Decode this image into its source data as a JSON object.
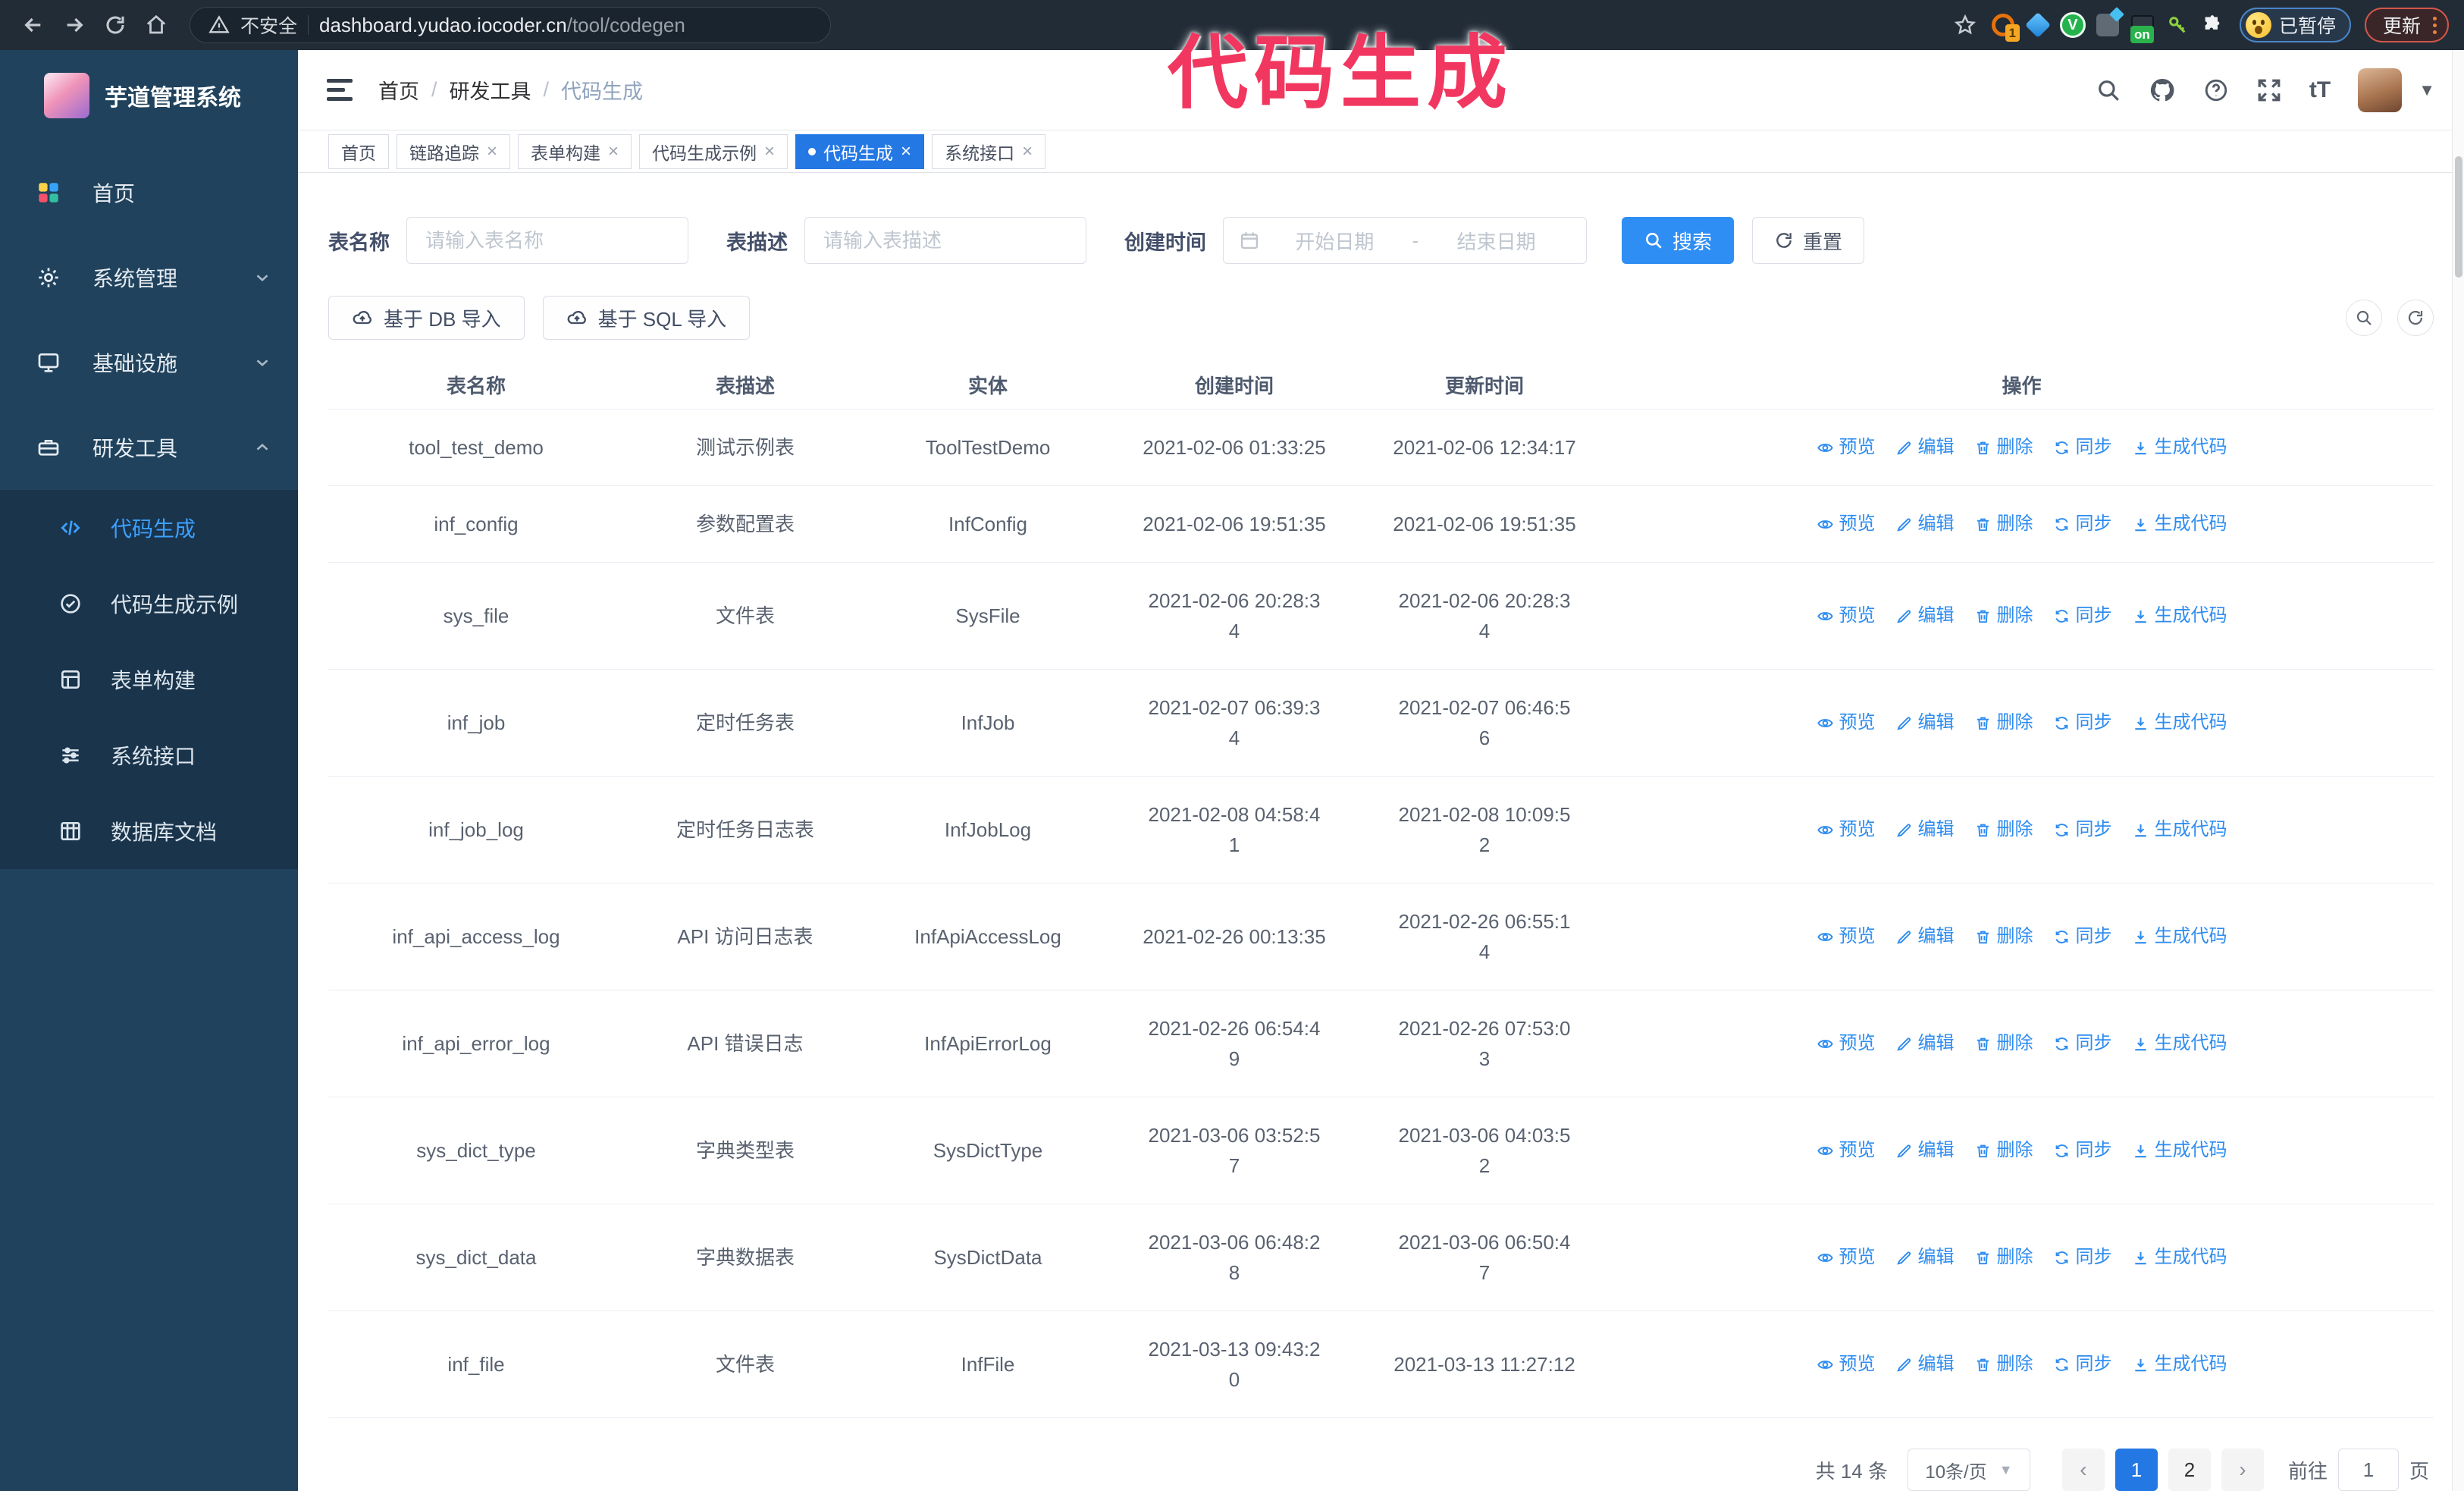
{
  "browser": {
    "security_label": "不安全",
    "url_host": "dashboard.yudao.iocoder.cn",
    "url_path": "/tool/codegen",
    "extension_badge_count": "1",
    "extension_badge_on": "on",
    "profile_badge": "已暂停",
    "update_button": "更新"
  },
  "annotation": {
    "text": "代码生成",
    "color": "#f1375f"
  },
  "sidebar": {
    "app_title": "芋道管理系统",
    "menu": [
      {
        "label": "首页",
        "icon": "dashboard-icon",
        "chevron": null
      },
      {
        "label": "系统管理",
        "icon": "gear-icon",
        "chevron": "down"
      },
      {
        "label": "基础设施",
        "icon": "monitor-icon",
        "chevron": "down"
      },
      {
        "label": "研发工具",
        "icon": "toolbox-icon",
        "chevron": "up"
      }
    ],
    "submenu": [
      {
        "label": "代码生成",
        "icon": "code-icon",
        "active": true
      },
      {
        "label": "代码生成示例",
        "icon": "example-icon",
        "active": false
      },
      {
        "label": "表单构建",
        "icon": "form-icon",
        "active": false
      },
      {
        "label": "系统接口",
        "icon": "api-icon",
        "active": false
      },
      {
        "label": "数据库文档",
        "icon": "db-doc-icon",
        "active": false
      }
    ]
  },
  "header": {
    "breadcrumb": [
      "首页",
      "研发工具",
      "代码生成"
    ]
  },
  "tabs": [
    {
      "label": "首页",
      "closable": false,
      "active": false
    },
    {
      "label": "链路追踪",
      "closable": true,
      "active": false
    },
    {
      "label": "表单构建",
      "closable": true,
      "active": false
    },
    {
      "label": "代码生成示例",
      "closable": true,
      "active": false
    },
    {
      "label": "代码生成",
      "closable": true,
      "active": true
    },
    {
      "label": "系统接口",
      "closable": true,
      "active": false
    }
  ],
  "search": {
    "table_name_label": "表名称",
    "table_name_placeholder": "请输入表名称",
    "table_desc_label": "表描述",
    "table_desc_placeholder": "请输入表描述",
    "create_time_label": "创建时间",
    "start_date_placeholder": "开始日期",
    "range_separator": "-",
    "end_date_placeholder": "结束日期",
    "search_button": "搜索",
    "reset_button": "重置"
  },
  "toolbar": {
    "import_db_button": "基于 DB 导入",
    "import_sql_button": "基于 SQL 导入"
  },
  "table": {
    "columns": [
      "表名称",
      "表描述",
      "实体",
      "创建时间",
      "更新时间",
      "操作"
    ],
    "actions": [
      {
        "label": "预览",
        "icon": "eye-icon"
      },
      {
        "label": "编辑",
        "icon": "edit-icon"
      },
      {
        "label": "删除",
        "icon": "trash-icon"
      },
      {
        "label": "同步",
        "icon": "sync-icon"
      },
      {
        "label": "生成代码",
        "icon": "download-icon"
      }
    ],
    "rows": [
      {
        "name": "tool_test_demo",
        "desc": "测试示例表",
        "entity": "ToolTestDemo",
        "created": [
          "2021-02-06 01:33:25"
        ],
        "updated": [
          "2021-02-06 12:34:17"
        ]
      },
      {
        "name": "inf_config",
        "desc": "参数配置表",
        "entity": "InfConfig",
        "created": [
          "2021-02-06 19:51:35"
        ],
        "updated": [
          "2021-02-06 19:51:35"
        ]
      },
      {
        "name": "sys_file",
        "desc": "文件表",
        "entity": "SysFile",
        "created": [
          "2021-02-06 20:28:3",
          "4"
        ],
        "updated": [
          "2021-02-06 20:28:3",
          "4"
        ]
      },
      {
        "name": "inf_job",
        "desc": "定时任务表",
        "entity": "InfJob",
        "created": [
          "2021-02-07 06:39:3",
          "4"
        ],
        "updated": [
          "2021-02-07 06:46:5",
          "6"
        ]
      },
      {
        "name": "inf_job_log",
        "desc": "定时任务日志表",
        "entity": "InfJobLog",
        "created": [
          "2021-02-08 04:58:4",
          "1"
        ],
        "updated": [
          "2021-02-08 10:09:5",
          "2"
        ]
      },
      {
        "name": "inf_api_access_log",
        "desc": "API 访问日志表",
        "entity": "InfApiAccessLog",
        "created": [
          "2021-02-26 00:13:35"
        ],
        "updated": [
          "2021-02-26 06:55:1",
          "4"
        ]
      },
      {
        "name": "inf_api_error_log",
        "desc": "API 错误日志",
        "entity": "InfApiErrorLog",
        "created": [
          "2021-02-26 06:54:4",
          "9"
        ],
        "updated": [
          "2021-02-26 07:53:0",
          "3"
        ]
      },
      {
        "name": "sys_dict_type",
        "desc": "字典类型表",
        "entity": "SysDictType",
        "created": [
          "2021-03-06 03:52:5",
          "7"
        ],
        "updated": [
          "2021-03-06 04:03:5",
          "2"
        ]
      },
      {
        "name": "sys_dict_data",
        "desc": "字典数据表",
        "entity": "SysDictData",
        "created": [
          "2021-03-06 06:48:2",
          "8"
        ],
        "updated": [
          "2021-03-06 06:50:4",
          "7"
        ]
      },
      {
        "name": "inf_file",
        "desc": "文件表",
        "entity": "InfFile",
        "created": [
          "2021-03-13 09:43:2",
          "0"
        ],
        "updated": [
          "2021-03-13 11:27:12"
        ]
      }
    ]
  },
  "pagination": {
    "total_label": "共 14 条",
    "page_size_label": "10条/页",
    "prev_icon": "‹",
    "next_icon": "›",
    "pages": [
      "1",
      "2"
    ],
    "active_page": "1",
    "goto_label": "前往",
    "goto_value": "1",
    "page_unit_label": "页"
  },
  "colors": {
    "primary": "#2d8cf0",
    "active_tab": "#2478e4",
    "sidebar_bg": "#20425c",
    "annotation": "#f1375f"
  }
}
